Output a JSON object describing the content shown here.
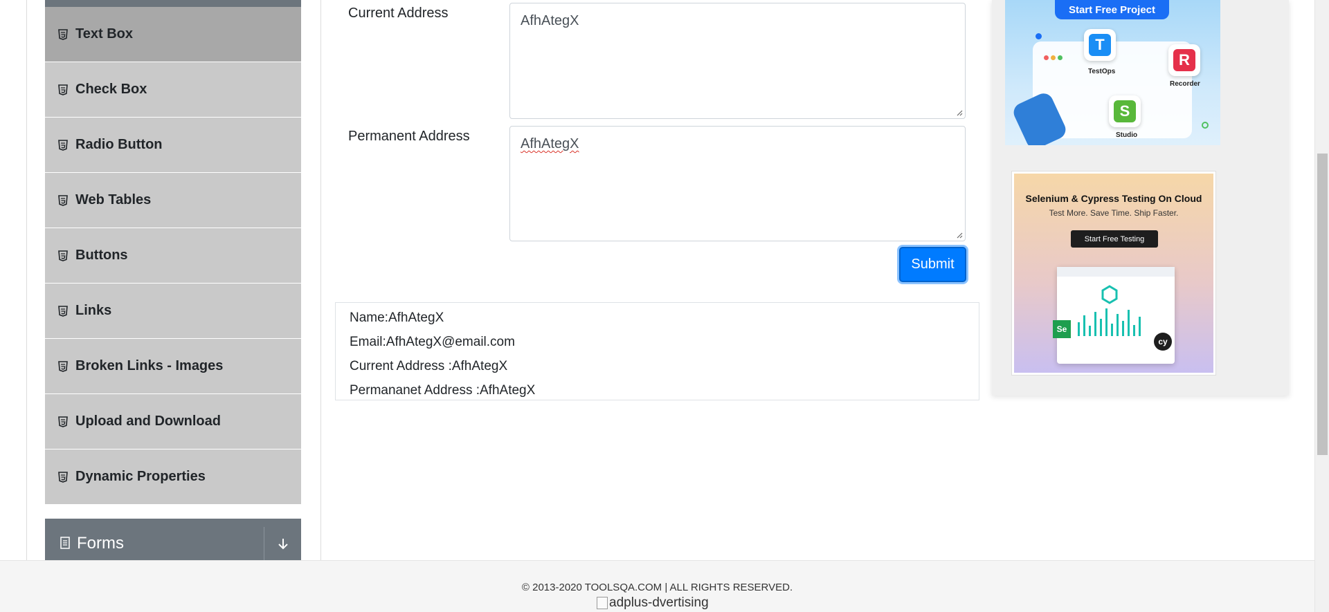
{
  "sidebar": {
    "items": [
      {
        "label": "Text Box",
        "active": true
      },
      {
        "label": "Check Box"
      },
      {
        "label": "Radio Button"
      },
      {
        "label": "Web Tables"
      },
      {
        "label": "Buttons"
      },
      {
        "label": "Links"
      },
      {
        "label": "Broken Links - Images"
      },
      {
        "label": "Upload and Download"
      },
      {
        "label": "Dynamic Properties"
      }
    ],
    "group": {
      "label": "Forms"
    }
  },
  "form": {
    "current_address_label": "Current Address",
    "current_address_value": "AfhAtegX",
    "permanent_address_label": "Permanent Address",
    "permanent_address_value": "AfhAtegX",
    "submit_label": "Submit"
  },
  "output": {
    "name": "Name:AfhAtegX",
    "email": "Email:AfhAtegX@email.com",
    "current_address": "Current Address :AfhAtegX",
    "permanent_address": "Permananet Address :AfhAtegX"
  },
  "ads": {
    "ad1": {
      "cta": "Start Free Project",
      "testops": "TestOps",
      "recorder": "Recorder",
      "studio": "Studio"
    },
    "ad2": {
      "title": "Selenium & Cypress Testing On Cloud",
      "subtitle": "Test More. Save Time. Ship Faster.",
      "cta": "Start Free Testing"
    }
  },
  "footer": {
    "copyright": "© 2013-2020 TOOLSQA.COM | ALL RIGHTS RESERVED.",
    "ad_alt": "adplus-dvertising"
  },
  "colors": {
    "primary": "#007bff",
    "sidebar_item": "#c9c9c9",
    "sidebar_active": "#a8a8a8",
    "group_header": "#6c757d"
  },
  "icons": {
    "menu_item": "html5-icon",
    "forms": "document-icon",
    "toggle": "arrow-down-icon"
  }
}
